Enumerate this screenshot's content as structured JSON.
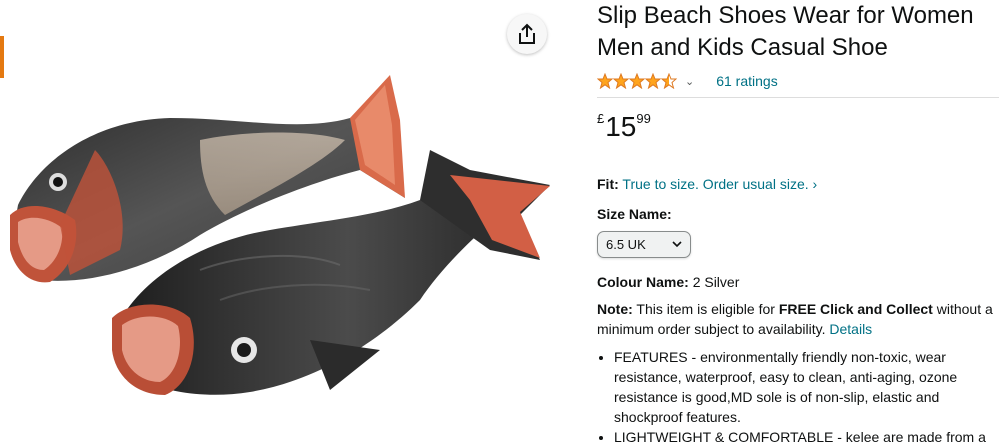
{
  "product": {
    "title": "Slip Beach Shoes Wear for Women Men and Kids Casual Shoe",
    "stars": 4.5,
    "ratings_text": "61 ratings",
    "price": {
      "currency": "£",
      "whole": "15",
      "fraction": "99"
    },
    "fit": {
      "label": "Fit:",
      "text": "True to size. Order usual size."
    },
    "size": {
      "label": "Size Name:",
      "selected": "6.5 UK"
    },
    "colour": {
      "label": "Colour Name:",
      "value": "2 Silver"
    },
    "note": {
      "label": "Note:",
      "text_before": "This item is eligible for",
      "bold": "FREE Click and Collect",
      "text_after": "without a minimum order subject to availability.",
      "link": "Details"
    },
    "bullets": [
      "FEATURES - environmentally friendly non-toxic, wear resistance, waterproof, easy to clean, anti-aging, ozone resistance is good,MD sole is of non-slip, elastic and shockproof features.",
      "LIGHTWEIGHT & COMFORTABLE - kelee are made from a"
    ]
  },
  "icons": {
    "share": "share-icon",
    "rating_chevron": "chevron-down-icon",
    "fit_chevron": "chevron-right-icon",
    "select_chevron": "chevron-down-icon"
  },
  "colors": {
    "link": "#007185",
    "star": "#ffa41c",
    "accent": "#e47911"
  }
}
